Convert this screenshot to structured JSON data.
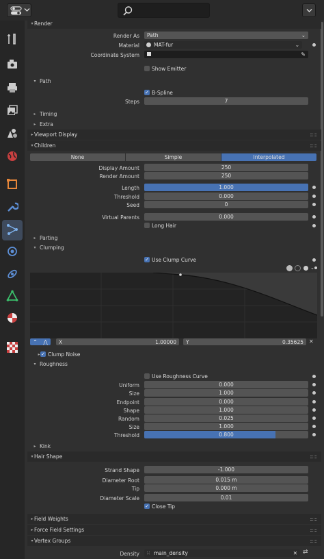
{
  "header": {
    "search_icon": "search-icon",
    "editor_type_icon": "editor-type-icon",
    "menu_icon": "chevron-down-icon"
  },
  "sidebar": {
    "tabs": [
      "tool",
      "render",
      "output",
      "view-layer",
      "scene",
      "world",
      "object",
      "modifier",
      "particles",
      "physics",
      "constraints",
      "data",
      "material",
      "texture"
    ],
    "active": "particles"
  },
  "render": {
    "title": "Render",
    "render_as_label": "Render As",
    "render_as_value": "Path",
    "material_label": "Material",
    "material_value": "MAT-fur",
    "coord_label": "Coordinate System",
    "coord_value": "",
    "show_emitter_label": "Show Emitter"
  },
  "path": {
    "title": "Path",
    "bspline_label": "B-Spline",
    "steps_label": "Steps",
    "steps_value": "7"
  },
  "timing": {
    "title": "Timing"
  },
  "extra": {
    "title": "Extra"
  },
  "viewport_display": {
    "title": "Viewport Display"
  },
  "children": {
    "title": "Children",
    "modes": [
      "None",
      "Simple",
      "Interpolated"
    ],
    "active_mode": "Interpolated",
    "display_amount_label": "Display Amount",
    "display_amount_value": "250",
    "render_amount_label": "Render Amount",
    "render_amount_value": "250",
    "length_label": "Length",
    "length_value": "1.000",
    "length_fill": 1.0,
    "threshold_label": "Threshold",
    "threshold_value": "0.000",
    "seed_label": "Seed",
    "seed_value": "0",
    "virtual_parents_label": "Virtual Parents",
    "virtual_parents_value": "0.000",
    "long_hair_label": "Long Hair"
  },
  "parting": {
    "title": "Parting"
  },
  "clumping": {
    "title": "Clumping",
    "use_clump_curve_label": "Use Clump Curve",
    "curve_x_label": "X",
    "curve_x_value": "1.00000",
    "curve_y_label": "Y",
    "curve_y_value": "0.35625",
    "clump_noise_label": "Clump Noise"
  },
  "roughness": {
    "title": "Roughness",
    "use_roughness_curve_label": "Use Roughness Curve",
    "uniform_label": "Uniform",
    "uniform_value": "0.000",
    "size1_label": "Size",
    "size1_value": "1.000",
    "endpoint_label": "Endpoint",
    "endpoint_value": "0.000",
    "shape_label": "Shape",
    "shape_value": "1.000",
    "random_label": "Random",
    "random_value": "0.025",
    "size2_label": "Size",
    "size2_value": "1.000",
    "threshold_label": "Threshold",
    "threshold_value": "0.800",
    "threshold_fill": 0.8
  },
  "kink": {
    "title": "Kink"
  },
  "hair_shape": {
    "title": "Hair Shape",
    "strand_shape_label": "Strand Shape",
    "strand_shape_value": "-1.000",
    "diameter_root_label": "Diameter Root",
    "diameter_root_value": "0.015 m",
    "tip_label": "Tip",
    "tip_value": "0.000 m",
    "diameter_scale_label": "Diameter Scale",
    "diameter_scale_value": "0.01",
    "close_tip_label": "Close Tip"
  },
  "field_weights": {
    "title": "Field Weights"
  },
  "force_field": {
    "title": "Force Field Settings"
  },
  "vertex_groups": {
    "title": "Vertex Groups",
    "density_label": "Density",
    "density_value": "main_density"
  },
  "colors": {
    "accent": "#4772b3",
    "panel": "#303030",
    "header": "#2a2a2a",
    "field": "#545454"
  }
}
